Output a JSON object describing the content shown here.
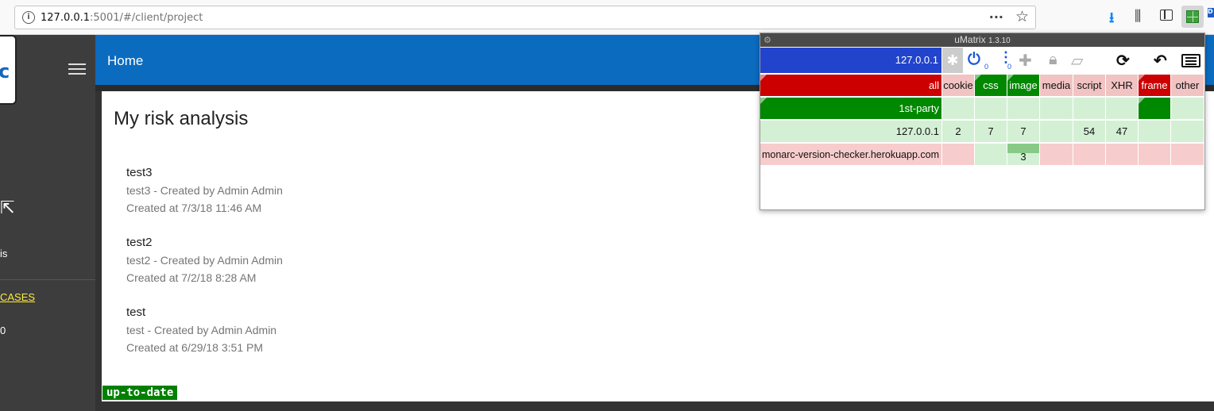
{
  "browser": {
    "url_host": "127.0.0.1",
    "url_rest": ":5001/#/client/project",
    "page_actions": "···",
    "bookmark_star": "☆",
    "edge_badge": "D"
  },
  "sidebar": {
    "logo_glyph": "c",
    "items": [
      {
        "label": "is"
      },
      {
        "label": "CASES"
      },
      {
        "label": "0"
      }
    ]
  },
  "header": {
    "title": "Home"
  },
  "main": {
    "title": "My risk analysis",
    "analyses": [
      {
        "name": "test3",
        "description": "test3 - Created by Admin Admin",
        "created": "Created at 7/3/18 11:46 AM"
      },
      {
        "name": "test2",
        "description": "test2 - Created by Admin Admin",
        "created": "Created at 7/2/18 8:28 AM"
      },
      {
        "name": "test",
        "description": "test - Created by Admin Admin",
        "created": "Created at 6/29/18 3:51 PM"
      }
    ],
    "status_badge": "up-to-date"
  },
  "umatrix": {
    "title": "uMatrix",
    "version": "1.3.10",
    "scope": "127.0.0.1",
    "power_count": "0",
    "dots_count": "0",
    "columns": [
      "cookie",
      "css",
      "image",
      "media",
      "script",
      "XHR",
      "frame",
      "other"
    ],
    "rows": [
      {
        "host": "all",
        "cells": [
          "",
          "",
          "",
          "",
          "",
          "",
          "",
          ""
        ]
      },
      {
        "host": "1st-party",
        "cells": [
          "",
          "",
          "",
          "",
          "",
          "",
          "",
          ""
        ]
      },
      {
        "host": "127.0.0.1",
        "cells": [
          "2",
          "7",
          "7",
          "",
          "54",
          "47",
          "",
          ""
        ]
      },
      {
        "host": "monarc-version-checker.herokuapp.com",
        "cells": [
          "",
          "",
          "3",
          "",
          "",
          "",
          "",
          ""
        ]
      }
    ]
  },
  "colors": {
    "header_blue": "#0b6bbf",
    "sidebar_dark": "#3d3d3d",
    "badge_green": "#008000",
    "matrix_block": "#cc0000",
    "matrix_allow": "#008800"
  }
}
